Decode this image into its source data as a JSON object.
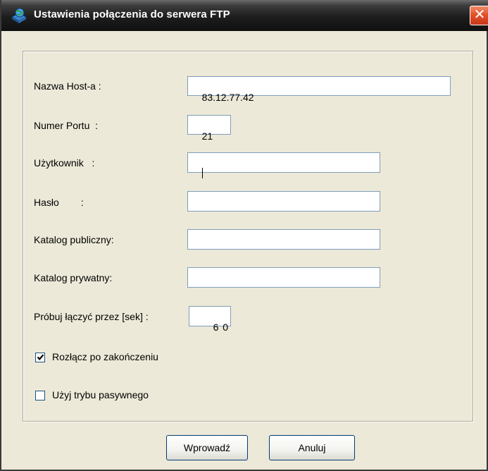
{
  "window": {
    "title": "Ustawienia połączenia do serwera FTP",
    "close_glyph": "✕",
    "icon": "ftp-globe-icon"
  },
  "form": {
    "host_label": "Nazwa Host-a :",
    "host_value": "83.12.77.42",
    "port_label": "Numer Portu  :",
    "port_value": "21",
    "user_label": "Użytkownik   :",
    "user_value": "",
    "password_label": "Hasło        :",
    "password_value": "",
    "public_dir_label": "Katalog publiczny:",
    "public_dir_value": "",
    "private_dir_label": "Katalog prywatny:",
    "private_dir_value": "",
    "timeout_label": "Próbuj łączyć przez [sek] :",
    "timeout_value": "6 0"
  },
  "options": {
    "disconnect_label": "Rozłącz po zakończeniu",
    "disconnect_checked": true,
    "passive_label": "Użyj trybu pasywnego",
    "passive_checked": false
  },
  "buttons": {
    "ok_label": "Wprowadź",
    "cancel_label": "Anuluj"
  }
}
